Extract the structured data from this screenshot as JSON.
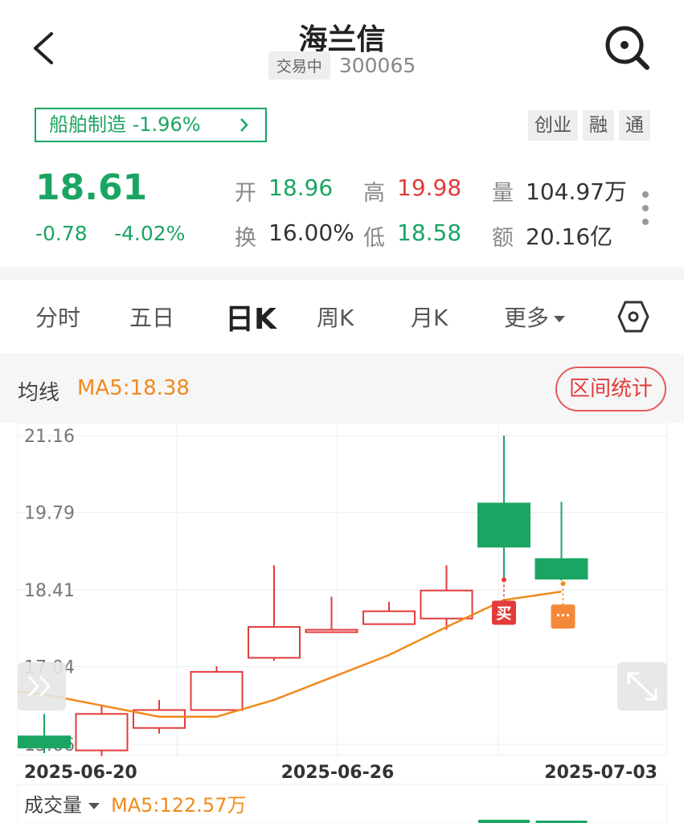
{
  "header": {
    "title": "海兰信",
    "status": "交易中",
    "code": "300065"
  },
  "sector": {
    "label": "船舶制造 -1.96%"
  },
  "tags": [
    "创业",
    "融",
    "通"
  ],
  "quote": {
    "price": "18.61",
    "change": "-0.78",
    "change_pct": "-4.02%",
    "open_label": "开",
    "open": "18.96",
    "high_label": "高",
    "high": "19.98",
    "volume_label": "量",
    "volume": "104.97万",
    "turnover_label": "换",
    "turnover": "16.00%",
    "low_label": "低",
    "low": "18.58",
    "amount_label": "额",
    "amount": "20.16亿"
  },
  "tabs": [
    {
      "label": "分时"
    },
    {
      "label": "五日"
    },
    {
      "label": "日K"
    },
    {
      "label": "周K"
    },
    {
      "label": "月K"
    },
    {
      "label": "更多"
    }
  ],
  "ma": {
    "label": "均线",
    "value": "MA5:18.38"
  },
  "range_button": "区间统计",
  "volume_bar": {
    "label": "成交量",
    "ma": "MA5:122.57万"
  },
  "markers": {
    "buy": "买",
    "more": "···"
  },
  "colors": {
    "up": "#e33b3b",
    "down": "#1aa562",
    "ma5": "#f08a1c"
  },
  "chart_data": {
    "type": "candlestick",
    "y_ticks": [
      "21.16",
      "19.79",
      "18.41",
      "17.04",
      "15.66"
    ],
    "ylim": [
      15.66,
      21.16
    ],
    "x_labels": [
      "2025-06-20",
      "2025-06-26",
      "2025-07-03"
    ],
    "candles": [
      {
        "open": 15.8,
        "close": 15.6,
        "high": 16.2,
        "low": 15.5
      },
      {
        "open": 15.55,
        "close": 16.2,
        "high": 16.35,
        "low": 15.45
      },
      {
        "open": 15.95,
        "close": 16.27,
        "high": 16.45,
        "low": 15.85
      },
      {
        "open": 16.27,
        "close": 16.95,
        "high": 17.05,
        "low": 16.27
      },
      {
        "open": 17.2,
        "close": 17.75,
        "high": 18.85,
        "low": 17.15
      },
      {
        "open": 17.68,
        "close": 17.7,
        "high": 18.29,
        "low": 17.65
      },
      {
        "open": 17.8,
        "close": 18.03,
        "high": 18.2,
        "low": 17.8
      },
      {
        "open": 17.9,
        "close": 18.4,
        "high": 18.85,
        "low": 17.7
      },
      {
        "open": 19.95,
        "close": 19.18,
        "high": 21.16,
        "low": 18.59
      },
      {
        "open": 18.96,
        "close": 18.61,
        "high": 19.98,
        "low": 18.58
      }
    ],
    "ma5": [
      16.55,
      16.35,
      16.15,
      16.15,
      16.45,
      16.85,
      17.25,
      17.75,
      18.23,
      18.38
    ]
  }
}
